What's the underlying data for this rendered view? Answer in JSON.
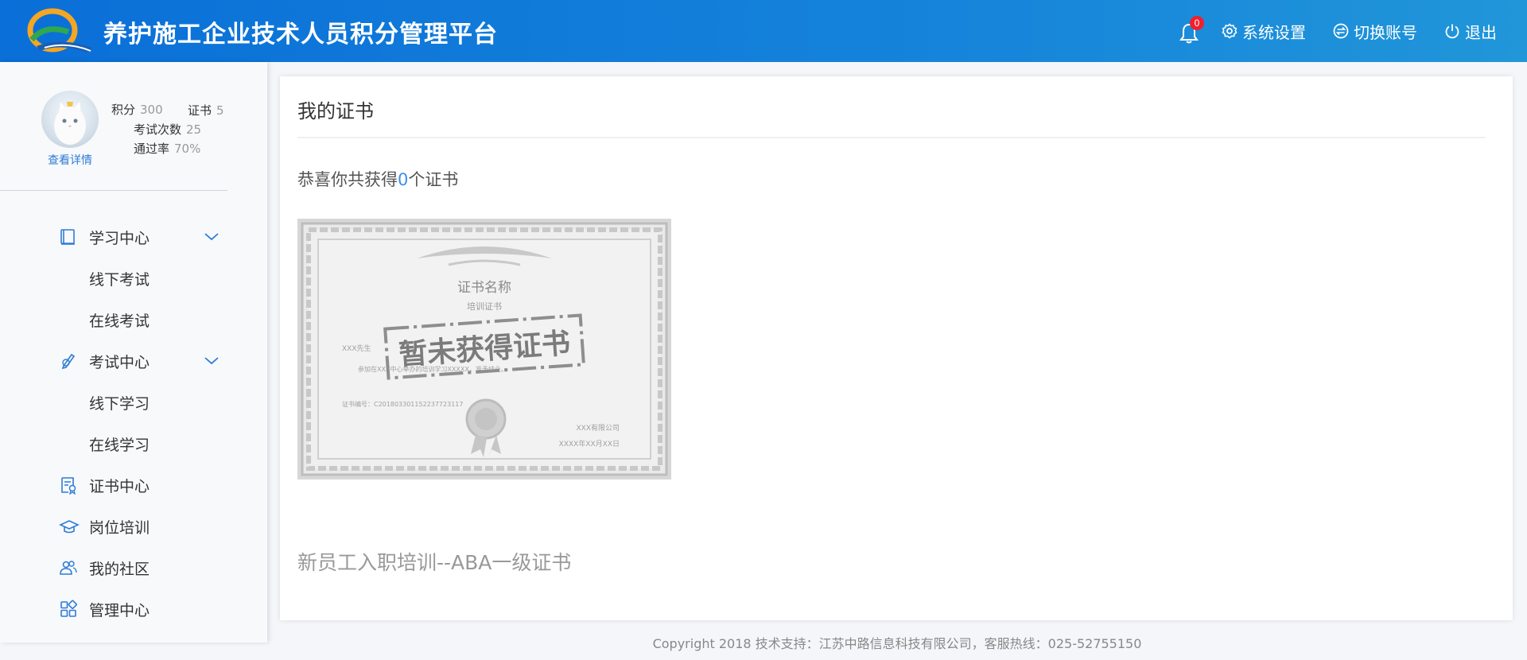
{
  "header": {
    "app_title": "养护施工企业技术人员积分管理平台",
    "notification_count": "0",
    "settings_label": "系统设置",
    "switch_account_label": "切换账号",
    "logout_label": "退出"
  },
  "user": {
    "points_label": "积分",
    "points_value": "300",
    "certs_label": "证书",
    "certs_value": "5",
    "exams_label": "考试次数",
    "exams_value": "25",
    "pass_rate_label": "通过率",
    "pass_rate_value": "70%",
    "view_detail": "查看详情"
  },
  "sidebar": {
    "items": [
      {
        "label": "学习中心",
        "icon": "book-icon",
        "expandable": true
      },
      {
        "label": "线下考试",
        "sub": true
      },
      {
        "label": "在线考试",
        "sub": true
      },
      {
        "label": "考试中心",
        "icon": "exam-pen-icon",
        "expandable": true
      },
      {
        "label": "线下学习",
        "sub": true
      },
      {
        "label": "在线学习",
        "sub": true
      },
      {
        "label": "证书中心",
        "icon": "certificate-icon"
      },
      {
        "label": "岗位培训",
        "icon": "graduation-cap-icon"
      },
      {
        "label": "我的社区",
        "icon": "community-icon"
      },
      {
        "label": "管理中心",
        "icon": "grid-icon"
      }
    ]
  },
  "main": {
    "title": "我的证书",
    "congrats_prefix": "恭喜你共获得",
    "congrats_count": "0",
    "congrats_suffix": "个证书",
    "certificate": {
      "heading": "证书名称",
      "subheading": "培训证书",
      "stamp_text": "暂未获得证书",
      "holder": "XXX先生",
      "body": "参加在XXX中心举办的培训学习XXXXX，准予结业。",
      "cert_number": "证书编号：C201803301152237723117",
      "issuer": "XXX有限公司",
      "date": "XXXX年XX月XX日"
    },
    "cert_name": "新员工入职培训--ABA一级证书"
  },
  "footer": {
    "text": "Copyright 2018 技术支持：江苏中路信息科技有限公司，客服热线：025-52755150"
  },
  "colors": {
    "header_start": "#0a6fd8",
    "header_end": "#2196d9",
    "accent": "#3b8ef2",
    "badge": "#f0202c"
  }
}
